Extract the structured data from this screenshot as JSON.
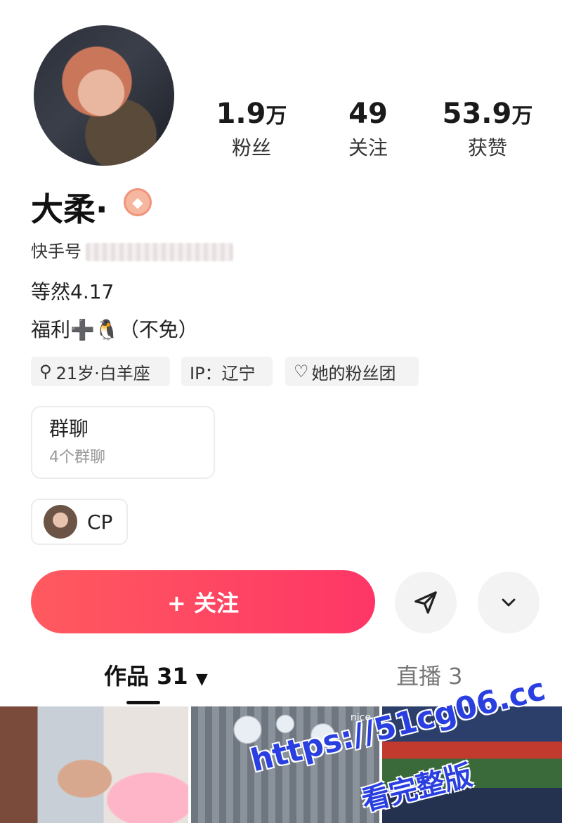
{
  "profile": {
    "name": "大柔·",
    "kuaishou_label": "快手号",
    "bio_line1": "等然4.17",
    "bio_line2": "福利➕🐧（不免）"
  },
  "stats": [
    {
      "num": "1.9",
      "unit": "万",
      "label": "粉丝"
    },
    {
      "num": "49",
      "unit": "",
      "label": "关注"
    },
    {
      "num": "53.9",
      "unit": "万",
      "label": "获赞"
    }
  ],
  "tags": {
    "age": "21岁·白羊座",
    "ip": "IP：辽宁",
    "fan_group": "她的粉丝团"
  },
  "group_card": {
    "title": "群聊",
    "subtitle": "4个群聊"
  },
  "cp": {
    "label": "CP"
  },
  "actions": {
    "follow": "+ 关注"
  },
  "tabs": {
    "works": "作品 31",
    "live": "直播 3"
  },
  "thumbs": {
    "t2_caption": "nice"
  },
  "watermark": {
    "line1": "https://51cg06.cc",
    "line2": "看完整版"
  },
  "colors": {
    "follow_start": "#ff5a5f",
    "follow_end": "#fe3666",
    "watermark": "#2a3fe0"
  }
}
